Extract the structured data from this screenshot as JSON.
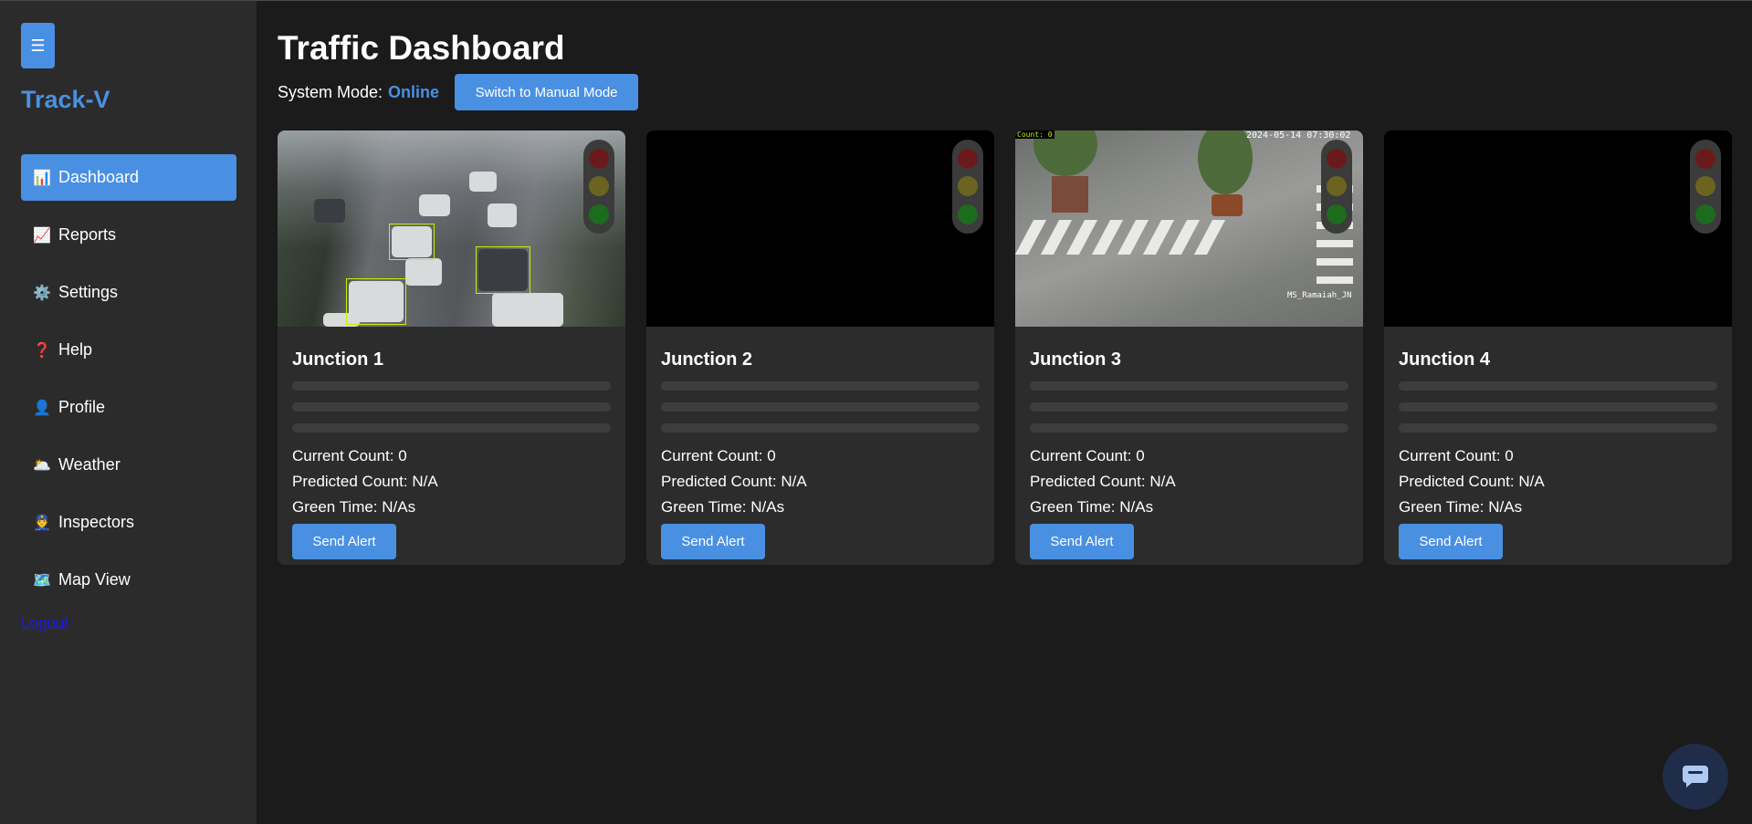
{
  "sidebar": {
    "menu_icon": "☰",
    "brand": "Track-V",
    "items": [
      {
        "icon": "📊",
        "label": "Dashboard",
        "icon_name": "bar-chart-icon"
      },
      {
        "icon": "📈",
        "label": "Reports",
        "icon_name": "trend-chart-icon"
      },
      {
        "icon": "⚙️",
        "label": "Settings",
        "icon_name": "gear-icon"
      },
      {
        "icon": "❓",
        "label": "Help",
        "icon_name": "question-icon"
      },
      {
        "icon": "👤",
        "label": "Profile",
        "icon_name": "user-icon"
      },
      {
        "icon": "🌥️",
        "label": "Weather",
        "icon_name": "weather-icon"
      },
      {
        "icon": "👮",
        "label": "Inspectors",
        "icon_name": "inspector-icon"
      },
      {
        "icon": "🗺️",
        "label": "Map View",
        "icon_name": "map-icon"
      }
    ],
    "active_index": 0,
    "logout": "Logout"
  },
  "header": {
    "title": "Traffic Dashboard",
    "mode_label": "System Mode:",
    "mode_value": "Online",
    "mode_button": "Switch to Manual Mode"
  },
  "junctions": [
    {
      "title": "Junction 1",
      "current": "Current Count: 0",
      "predicted": "Predicted Count: N/A",
      "green": "Green Time: N/As",
      "alert": "Send Alert"
    },
    {
      "title": "Junction 2",
      "current": "Current Count: 0",
      "predicted": "Predicted Count: N/A",
      "green": "Green Time: N/As",
      "alert": "Send Alert"
    },
    {
      "title": "Junction 3",
      "current": "Current Count: 0",
      "predicted": "Predicted Count: N/A",
      "green": "Green Time: N/As",
      "alert": "Send Alert"
    },
    {
      "title": "Junction 4",
      "current": "Current Count: 0",
      "predicted": "Predicted Count: N/A",
      "green": "Green Time: N/As",
      "alert": "Send Alert"
    }
  ],
  "feed3_overlay": {
    "count": "Count: 0",
    "timestamp": "2024-05-14 07:30:02",
    "camera": "MS_Ramaiah_JN"
  },
  "colors": {
    "accent": "#4a90e2",
    "background": "#1b1b1b",
    "sidebar": "#2b2b2b",
    "card": "#2c2c2c",
    "chat_button": "#1f2d4a"
  }
}
